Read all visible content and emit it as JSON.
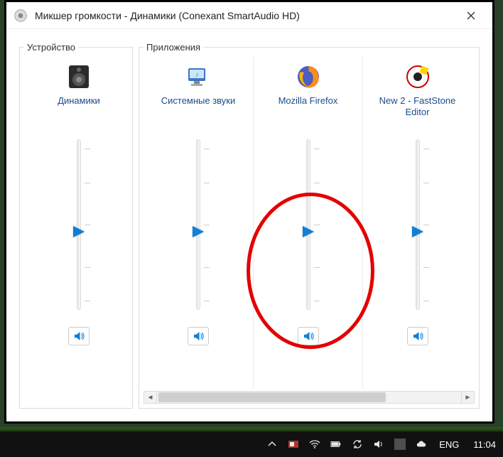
{
  "window": {
    "title": "Микшер громкости - Динамики (Conexant SmartAudio HD)"
  },
  "sections": {
    "device_label": "Устройство",
    "apps_label": "Приложения"
  },
  "channels": [
    {
      "id": "speakers",
      "name": "Динамики",
      "level": 46,
      "muted": false,
      "icon": "speaker-device"
    },
    {
      "id": "system",
      "name": "Системные звуки",
      "level": 46,
      "muted": false,
      "icon": "system-sounds"
    },
    {
      "id": "firefox",
      "name": "Mozilla Firefox",
      "level": 46,
      "muted": false,
      "icon": "firefox"
    },
    {
      "id": "faststone",
      "name": "New 2 - FastStone Editor",
      "level": 46,
      "muted": false,
      "icon": "faststone"
    }
  ],
  "annotation": {
    "circled_channel_id": "firefox"
  },
  "taskbar": {
    "language": "ENG",
    "time": "11:04",
    "tray": [
      "chevron-up",
      "photos-app",
      "wifi",
      "battery",
      "cloud-sync",
      "volume",
      "user",
      "onedrive"
    ]
  }
}
